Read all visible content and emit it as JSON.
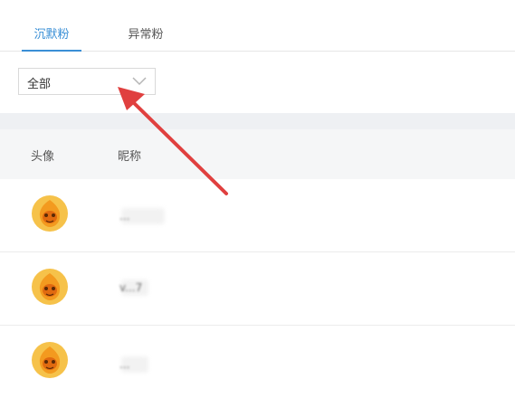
{
  "tabs": [
    {
      "label": "沉默粉",
      "active": true
    },
    {
      "label": "异常粉",
      "active": false
    }
  ],
  "filter": {
    "selected": "全部"
  },
  "table": {
    "headers": {
      "avatar": "头像",
      "nickname": "昵称"
    },
    "rows": [
      {
        "nickname": "..."
      },
      {
        "nickname": "v...7"
      },
      {
        "nickname": "..."
      }
    ]
  },
  "colors": {
    "accent": "#3a8fd6",
    "arrow": "#e0403f",
    "avatar_bg": "#f39a1f"
  },
  "icons": {
    "dropdown": "chevron-down-icon",
    "annotation": "red-arrow-annotation"
  }
}
